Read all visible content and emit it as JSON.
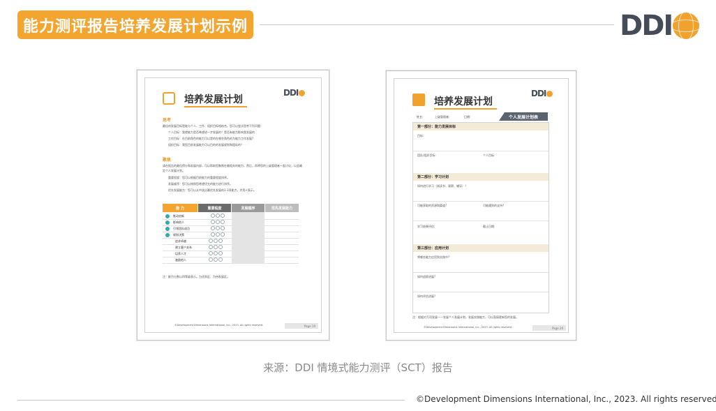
{
  "header": {
    "title": "能力测评报告培养发展计划示例",
    "logo_text": "DDI"
  },
  "left_page": {
    "title": "培养发展计划",
    "logo_text": "DDI",
    "section1_title": "思考",
    "section1_intro": "最佳的发展目标是能与个人、工作、组织目标相结合。您可以尝试思考下列问题:",
    "section1_items": [
      "个人目标：我就能力是否希望进一步发展的？是否有能力影响我发展的",
      "工作目标：在目前角色的能力可以是的在哪些角色的为能力工作发展?",
      "组织目标：我您目前发展能力可以目的的发展规划和国际的？"
    ],
    "section2_title": "聚焦",
    "section2_intro": "请在报告的最佳得分和发展内部，可以帮助您聚焦在最相关的能力，然后，再将您的上级管理者一起讨论，以此确定个人发展计划。",
    "section2_items": [
      "重要程度：您可以根据目前能力的重要程度排序。",
      "发展顺序：您可以按照您希望优先的能力进行排序。",
      "优先发展能力：您可以从中选出最优先发展的1-3项能力，并用✔表示。"
    ],
    "table_headers": [
      "能 力",
      "重要程度",
      "发展顺序",
      "优先发展能力"
    ],
    "table_rows": [
      "推动创新",
      "影响他人",
      "引领团队成功",
      "规划决策",
      "追求卓越",
      "建立客户关系",
      "培养人才",
      "激励他人"
    ],
    "footnote": "注：能力分数以四等级表示。为优势区、为待发展区。",
    "copyright": "©Development Dimensions International, Inc., 2023. All rights reserved.",
    "page_label": "Page 19"
  },
  "right_page": {
    "title": "培养发展计划",
    "logo_text": "DDI",
    "meta": [
      "姓名:",
      "上级管理者:",
      "日期:"
    ],
    "tab_label": "个人发展计划表",
    "part1": "第一部分：能力发展目标",
    "part1_fields": [
      "目标:",
      "团队/组织目标:",
      "个人目标:"
    ],
    "part2": "第二部分：学习计划",
    "part2_fields": [
      "如何进行学习（阅读书、观察、辅导）？",
      "可能获取的资源和渠道?",
      "可能遇到的支持?",
      "学习结果评估:",
      "截止日期:"
    ],
    "part3": "第三部分：应用计划",
    "part3_fields": [
      "将哪些能力应用到实践中?",
      "如何追踪进展?",
      "如何评估进展?"
    ],
    "footnote": "注：根据对几项发展——发展个人发展计划，发展实践能力，可以直接更新您的发展。",
    "copyright": "©Development Dimensions International, Inc., 2023. All rights reserved.",
    "page_label": "Page 20"
  },
  "source": "来源：DDI 情境式能力测评（SCT）报告",
  "footer": {
    "copyright": "©Development Dimensions International, Inc., 2023. All rights reserved."
  },
  "colors": {
    "accent": "#f3a530",
    "logo_gray": "#444d57",
    "table_gray": "#6b6b6b"
  }
}
